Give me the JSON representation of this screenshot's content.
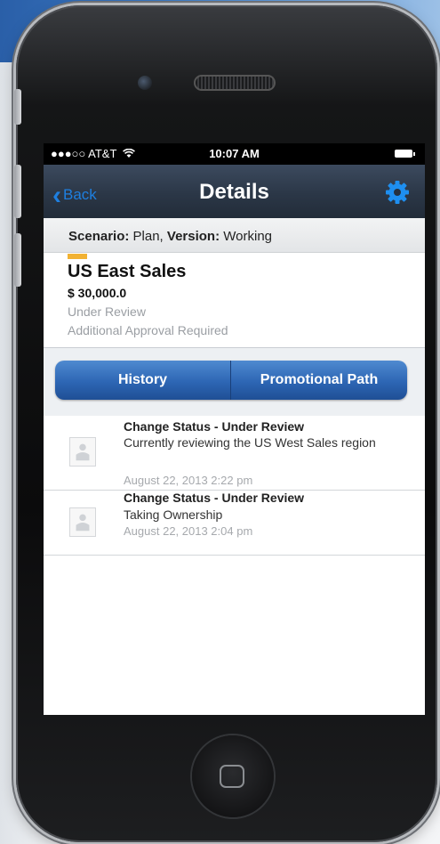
{
  "status_bar": {
    "carrier": "●●●○○ AT&T",
    "time": "10:07 AM"
  },
  "nav": {
    "back_label": "Back",
    "title": "Details",
    "settings_icon": "gear-icon"
  },
  "scenario_bar": {
    "scenario_label": "Scenario:",
    "scenario_value": "Plan,",
    "version_label": "Version:",
    "version_value": "Working"
  },
  "card": {
    "title": "US East Sales",
    "amount": "$ 30,000.0",
    "status": "Under Review",
    "approval": "Additional Approval Required",
    "tag_color": "#f2b233"
  },
  "segments": {
    "history": "History",
    "promotional_path": "Promotional Path"
  },
  "history": [
    {
      "title": "Change Status - Under Review",
      "description": "Currently reviewing the US West Sales region",
      "timestamp": "August 22, 2013 2:22 pm"
    },
    {
      "title": "Change Status - Under Review",
      "description": "Taking Ownership",
      "timestamp": "August 22, 2013 2:04 pm"
    }
  ],
  "colors": {
    "accent": "#1e7fe0",
    "segment_blue": "#2d66b4",
    "muted_text": "#9a9ea3"
  }
}
